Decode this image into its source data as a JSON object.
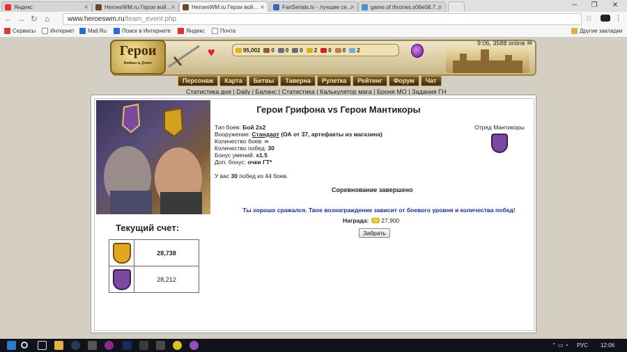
{
  "browser": {
    "tabs": [
      {
        "title": "Яндекс",
        "active": false,
        "color": "#e03030"
      },
      {
        "title": "HeroesWM.ru Герои вой…",
        "active": false,
        "color": "#6a4a20"
      },
      {
        "title": "HeroesWM.ru Герои вой…",
        "active": true,
        "color": "#6a4a20"
      },
      {
        "title": "FanSerials.tv - лучшие се…",
        "active": false,
        "color": "#3a6ab0"
      },
      {
        "title": "game.of.thrones.s06e08.7…",
        "active": false,
        "color": "#4a90d0"
      }
    ],
    "window_controls": [
      "─",
      "❐",
      "✕"
    ],
    "url_host": "www.heroeswm.ru",
    "url_path": "/team_event.php",
    "bookmarks": [
      {
        "label": "Сервисы",
        "color": "#d04030"
      },
      {
        "label": "Интернет",
        "color": "#888888"
      },
      {
        "label": "Mail.Ru",
        "color": "#2a6ad0"
      },
      {
        "label": "Поиск в Интернете",
        "color": "#2a6ad0"
      },
      {
        "label": "Яндекс",
        "color": "#e03030"
      },
      {
        "label": "Почта",
        "color": "#888888"
      }
    ],
    "other_bookmarks": "Другие закладки"
  },
  "game": {
    "logo_title": "Герои",
    "logo_subtitle": "Войны и Денег",
    "online": "9:06, 3588 online",
    "resources": [
      {
        "value": "95,002",
        "color": "#e0b020"
      },
      {
        "value": "0",
        "color": "#8a5a30"
      },
      {
        "value": "0",
        "color": "#6a6a7a"
      },
      {
        "value": "0",
        "color": "#6a6a7a"
      },
      {
        "value": "2",
        "color": "#d0b020"
      },
      {
        "value": "0",
        "color": "#d02020"
      },
      {
        "value": "0",
        "color": "#c08040"
      },
      {
        "value": "2",
        "color": "#6ab0e0"
      }
    ],
    "nav": [
      "Персонаж",
      "Карта",
      "Битвы",
      "Таверна",
      "Рулетка",
      "Рейтинг",
      "Форум",
      "Чат"
    ],
    "sublinks": "Статистика дня | Daily | Баланс | Статистика | Калькулятор мага | Броня МО | Задания ГН"
  },
  "event": {
    "title": "Герои Грифона vs Герои Мантикоры",
    "battle_type_label": "Тип боев:",
    "battle_type": "Бой 2х2",
    "armament_label": "Вооружение:",
    "armament_link": "Стандарт",
    "armament_note": "(ОА от 37, артефакты из магазина)",
    "battles_label": "Количество боев:",
    "battles": "∞",
    "wins_label": "Количество побед:",
    "wins": "30",
    "skill_bonus_label": "Бонус умений:",
    "skill_bonus": "x1.5",
    "extra_bonus_label": "Доп. бонус:",
    "extra_bonus": "очки ГТ*",
    "squad_label": "Отряд Мантикоры",
    "wins_prefix": "У вас",
    "wins_count": "30",
    "wins_suffix": "побед из 44 боев.",
    "finished": "Соревнование завершено",
    "message": "Ты хорошо сражался. Твое вознаграждение зависит от боевого уровня и количества побед!",
    "reward_label": "Награда:",
    "reward_value": "27,900",
    "take_button": "Забрать",
    "score_title": "Текущий счет:",
    "scores": [
      {
        "team": "gryphon",
        "value": "28,738",
        "bold": true
      },
      {
        "team": "manticore",
        "value": "28,212",
        "bold": false
      }
    ]
  },
  "taskbar": {
    "lang": "РУС",
    "time": "12:06"
  }
}
